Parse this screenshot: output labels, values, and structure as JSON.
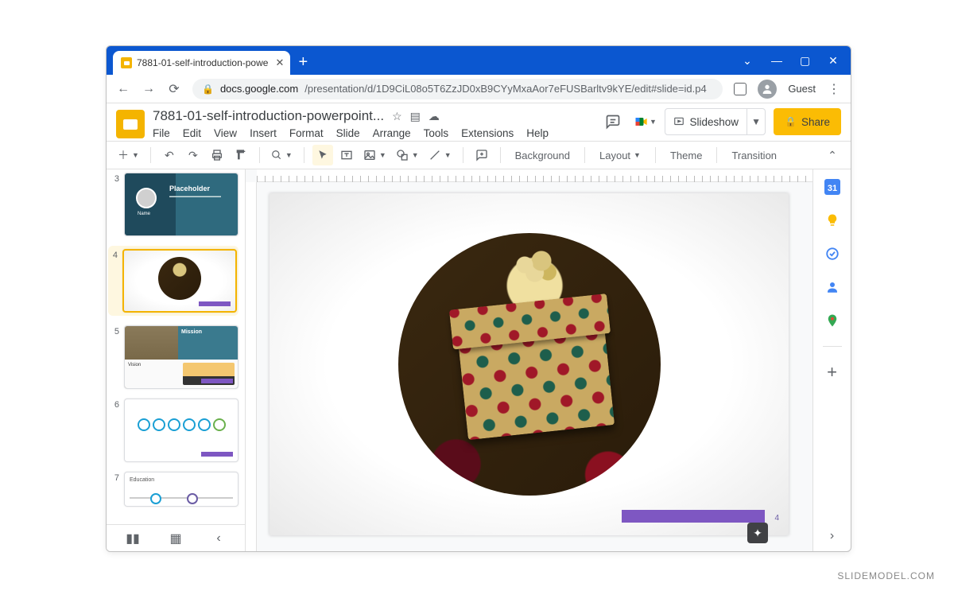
{
  "browser": {
    "tab_title": "7881-01-self-introduction-powe",
    "url_host": "docs.google.com",
    "url_path": "/presentation/d/1D9CiL08o5T6ZzJD0xB9CYyMxaAor7eFUSBarltv9kYE/edit#slide=id.p4",
    "guest_label": "Guest"
  },
  "window_controls": {
    "minimize": "—",
    "maximize": "▢",
    "close": "✕",
    "chevron": "⌄"
  },
  "docs": {
    "title": "7881-01-self-introduction-powerpoint...",
    "menus": [
      "File",
      "Edit",
      "View",
      "Insert",
      "Format",
      "Slide",
      "Arrange",
      "Tools",
      "Extensions",
      "Help"
    ],
    "slideshow": "Slideshow",
    "share": "Share"
  },
  "toolbar": {
    "background": "Background",
    "layout": "Layout",
    "theme": "Theme",
    "transition": "Transition"
  },
  "filmstrip": {
    "items": [
      {
        "num": "3",
        "title": "Placeholder",
        "name": "Name"
      },
      {
        "num": "4"
      },
      {
        "num": "5",
        "mission": "Mission",
        "vision": "Vision"
      },
      {
        "num": "6"
      },
      {
        "num": "7",
        "heading": "Education"
      }
    ],
    "selected_index": 1
  },
  "canvas": {
    "footer_page": "4",
    "accent_color": "#7e57c2"
  },
  "sidepanel": {
    "icons": [
      "calendar-icon",
      "keep-icon",
      "tasks-icon",
      "contacts-icon",
      "maps-icon"
    ]
  },
  "attribution": "SLIDEMODEL.COM"
}
